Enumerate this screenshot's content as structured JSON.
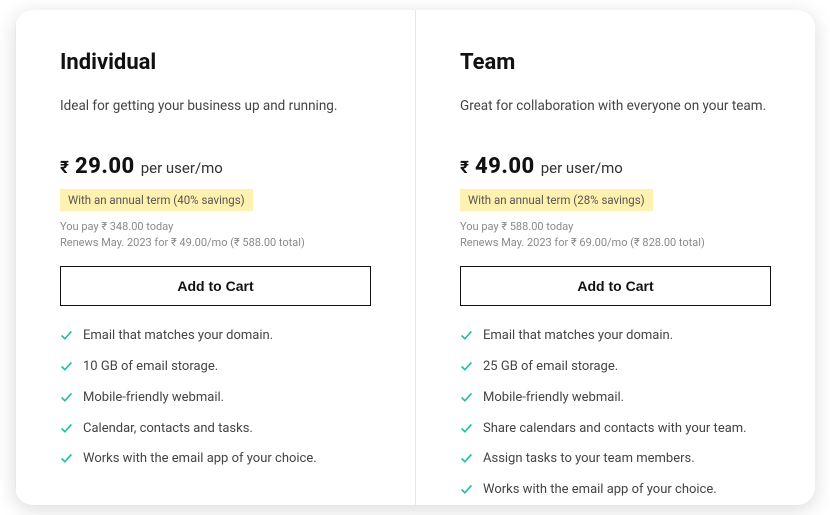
{
  "plans": [
    {
      "title": "Individual",
      "description": "Ideal for getting your business up and running.",
      "currency": "₹",
      "amount": "29.00",
      "per": "per user/mo",
      "savings": "With an annual term (40% savings)",
      "pay_today": "You pay ₹ 348.00 today",
      "renews": "Renews May. 2023 for ₹ 49.00/mo (₹ 588.00 total)",
      "button": "Add to Cart",
      "features": [
        "Email that matches your domain.",
        "10 GB of email storage.",
        "Mobile-friendly webmail.",
        "Calendar, contacts and tasks.",
        "Works with the email app of your choice."
      ]
    },
    {
      "title": "Team",
      "description": "Great for collaboration with everyone on your team.",
      "currency": "₹",
      "amount": "49.00",
      "per": "per user/mo",
      "savings": "With an annual term (28% savings)",
      "pay_today": "You pay ₹ 588.00 today",
      "renews": "Renews May. 2023 for ₹ 69.00/mo (₹ 828.00 total)",
      "button": "Add to Cart",
      "features": [
        "Email that matches your domain.",
        "25 GB of email storage.",
        "Mobile-friendly webmail.",
        "Share calendars and contacts with your team.",
        "Assign tasks to your team members.",
        "Works with the email app of your choice."
      ]
    }
  ]
}
